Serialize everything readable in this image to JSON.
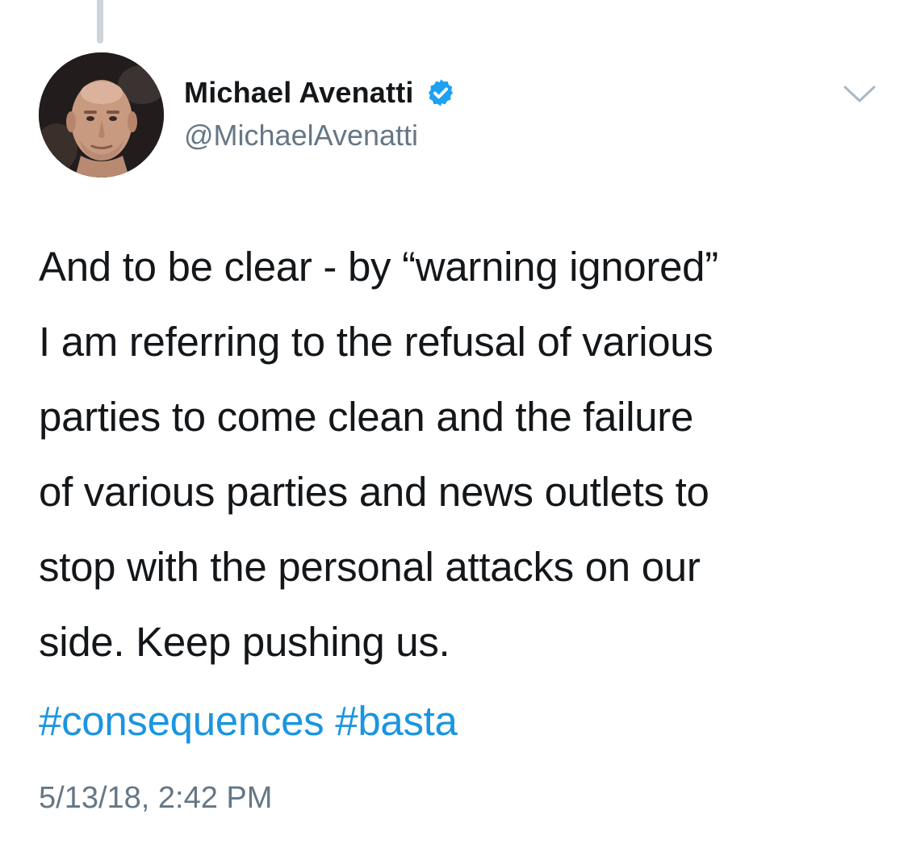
{
  "tweet": {
    "author": {
      "display_name": "Michael Avenatti",
      "handle": "@MichaelAvenatti",
      "verified": true
    },
    "text_lines": [
      "And to be clear - by “warning ignored”",
      "I am referring to the refusal of various",
      "parties to come clean and the failure",
      "of various parties and news outlets to",
      "stop with the personal attacks on our",
      "side. Keep pushing us."
    ],
    "hashtags": [
      "#consequences",
      "#basta"
    ],
    "timestamp": "5/13/18, 2:42 PM"
  },
  "icons": {
    "avatar": "profile-photo",
    "verified": "verified-badge-icon",
    "menu": "chevron-down-icon"
  },
  "colors": {
    "text": "#14171a",
    "secondary_text": "#657786",
    "link": "#1b95e0",
    "verified_badge": "#1da1f2",
    "thread_line": "#cdd5db"
  }
}
